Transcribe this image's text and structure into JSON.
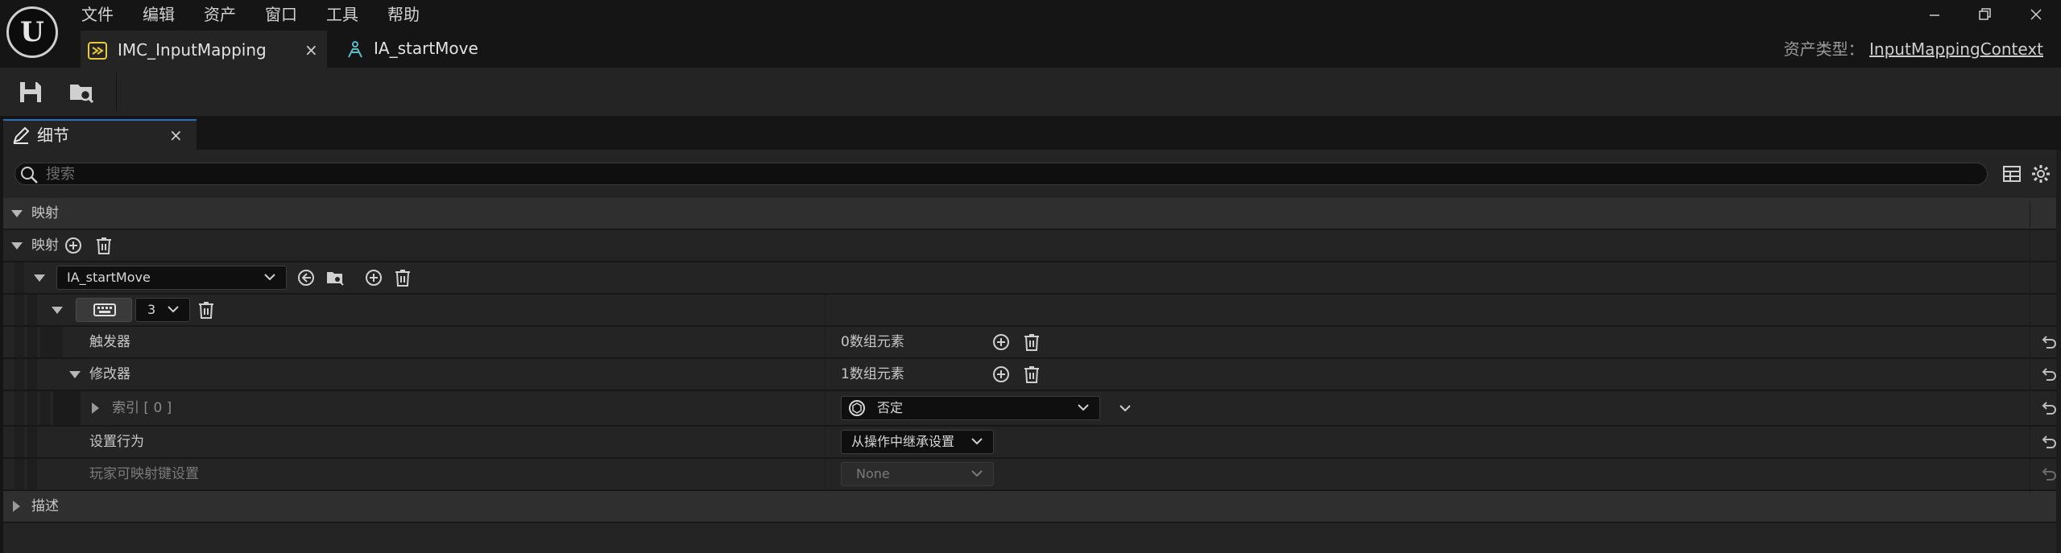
{
  "app": {
    "logo_letter": "U",
    "menu": [
      "文件",
      "编辑",
      "资产",
      "窗口",
      "工具",
      "帮助"
    ],
    "window_controls": [
      "minimize-icon",
      "restore-icon",
      "close-icon"
    ]
  },
  "tabs": [
    {
      "label": "IMC_InputMapping",
      "close": "×",
      "icon": "input-mapping-context-icon"
    },
    {
      "label": "IA_startMove",
      "icon": "input-action-icon"
    }
  ],
  "asset_type": {
    "label": "资产类型：",
    "value": "InputMappingContext"
  },
  "toolbar": {
    "save_icon": "save-icon",
    "browse_icon": "browse-to-asset-icon"
  },
  "panel": {
    "tab_label": "细节",
    "tab_close": "×",
    "search_placeholder": "搜索",
    "categories": {
      "mapping_section": "映射",
      "mappings_prop": "映射",
      "description": "描述"
    },
    "mapping_entry": {
      "action": "IA_startMove",
      "key_count": "3"
    },
    "properties": {
      "triggers": {
        "label": "触发器",
        "value": "0数组元素"
      },
      "modifiers": {
        "label": "修改器",
        "value": "1数组元素"
      },
      "index": {
        "label": "索引 [ 0 ]",
        "value": "否定"
      },
      "setting_behavior": {
        "label": "设置行为",
        "value": "从操作中继承设置"
      },
      "player_mappable": {
        "label": "玩家可映射键设置",
        "value": "None"
      }
    }
  },
  "colors": {
    "background": "#151515",
    "panel": "#242424",
    "accent": "#2f6fb5",
    "input_mapping_icon": "#e8c93a",
    "input_action_icon": "#5fb8c8"
  }
}
